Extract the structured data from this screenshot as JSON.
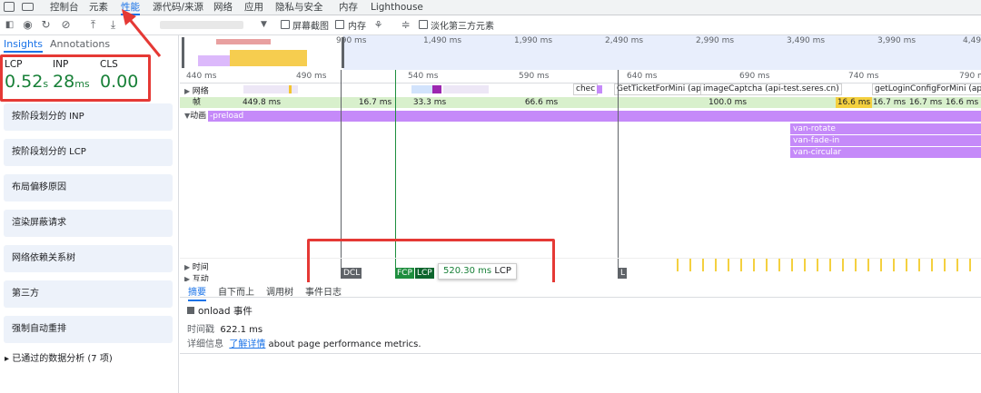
{
  "devtools": {
    "tabs": [
      "控制台",
      "元素",
      "性能",
      "源代码/来源",
      "网络",
      "应用",
      "隐私与安全",
      "内存",
      "Lighthouse"
    ],
    "active_tab": "性能"
  },
  "toolbar": {
    "checkboxes": [
      "屏幕截图",
      "内存",
      "淡化第三方元素"
    ]
  },
  "sidebar": {
    "tabs": [
      "Insights",
      "Annotations"
    ],
    "active_tab": "Insights",
    "metrics": [
      {
        "label": "LCP",
        "value": "0.52",
        "unit": "s"
      },
      {
        "label": "INP",
        "value": "28",
        "unit": "ms"
      },
      {
        "label": "CLS",
        "value": "0.00",
        "unit": ""
      }
    ],
    "insights": [
      "按阶段划分的 INP",
      "按阶段划分的 LCP",
      "布局偏移原因",
      "渲染屏蔽请求",
      "网络依赖关系树",
      "第三方",
      "强制自动重排"
    ],
    "passed": "▸ 已通过的数据分析 (7 项)"
  },
  "overview": {
    "ticks": [
      "990 ms",
      "1,490 ms",
      "1,990 ms",
      "2,490 ms",
      "2,990 ms",
      "3,490 ms",
      "3,990 ms",
      "4,490 ms"
    ]
  },
  "timeline": {
    "ticks": [
      "440 ms",
      "490 ms",
      "540 ms",
      "590 ms",
      "640 ms",
      "690 ms",
      "740 ms",
      "790 ms"
    ],
    "network_label": "网络",
    "network_requests": [
      "chec",
      "GetTicketForMini (api-",
      "imageCaptcha (api-test.seres.cn)",
      "getLoginConfigForMini (api-t"
    ],
    "frames_label": "帧",
    "frames": [
      "449.8 ms",
      "16.7 ms",
      "33.3 ms",
      "66.6 ms",
      "100.0 ms",
      "16.6 ms",
      "16.7 ms",
      "16.7 ms",
      "16.6 ms"
    ],
    "animations_label": "动画",
    "animations": [
      "-preload",
      "van-rotate",
      "van-fade-in",
      "van-circular"
    ],
    "timing_label": "时间",
    "interactions_label": "互动",
    "markers": [
      "DCL",
      "FCP",
      "LCP",
      "L"
    ],
    "tooltip_time": "520.30 ms",
    "tooltip_label": "LCP"
  },
  "details": {
    "tabs": [
      "摘要",
      "自下而上",
      "调用树",
      "事件日志"
    ],
    "active_tab": "摘要",
    "event_title": "onload 事件",
    "time_label": "时间戳",
    "time_value": "622.1 ms",
    "details_label": "详细信息",
    "details_link": "了解详情",
    "details_text": "about page performance metrics."
  },
  "colors": {
    "lcp_green": "#188038",
    "accent_blue": "#1a73e8",
    "animation_purple": "#c58af9",
    "annotation_red": "#e53935"
  }
}
